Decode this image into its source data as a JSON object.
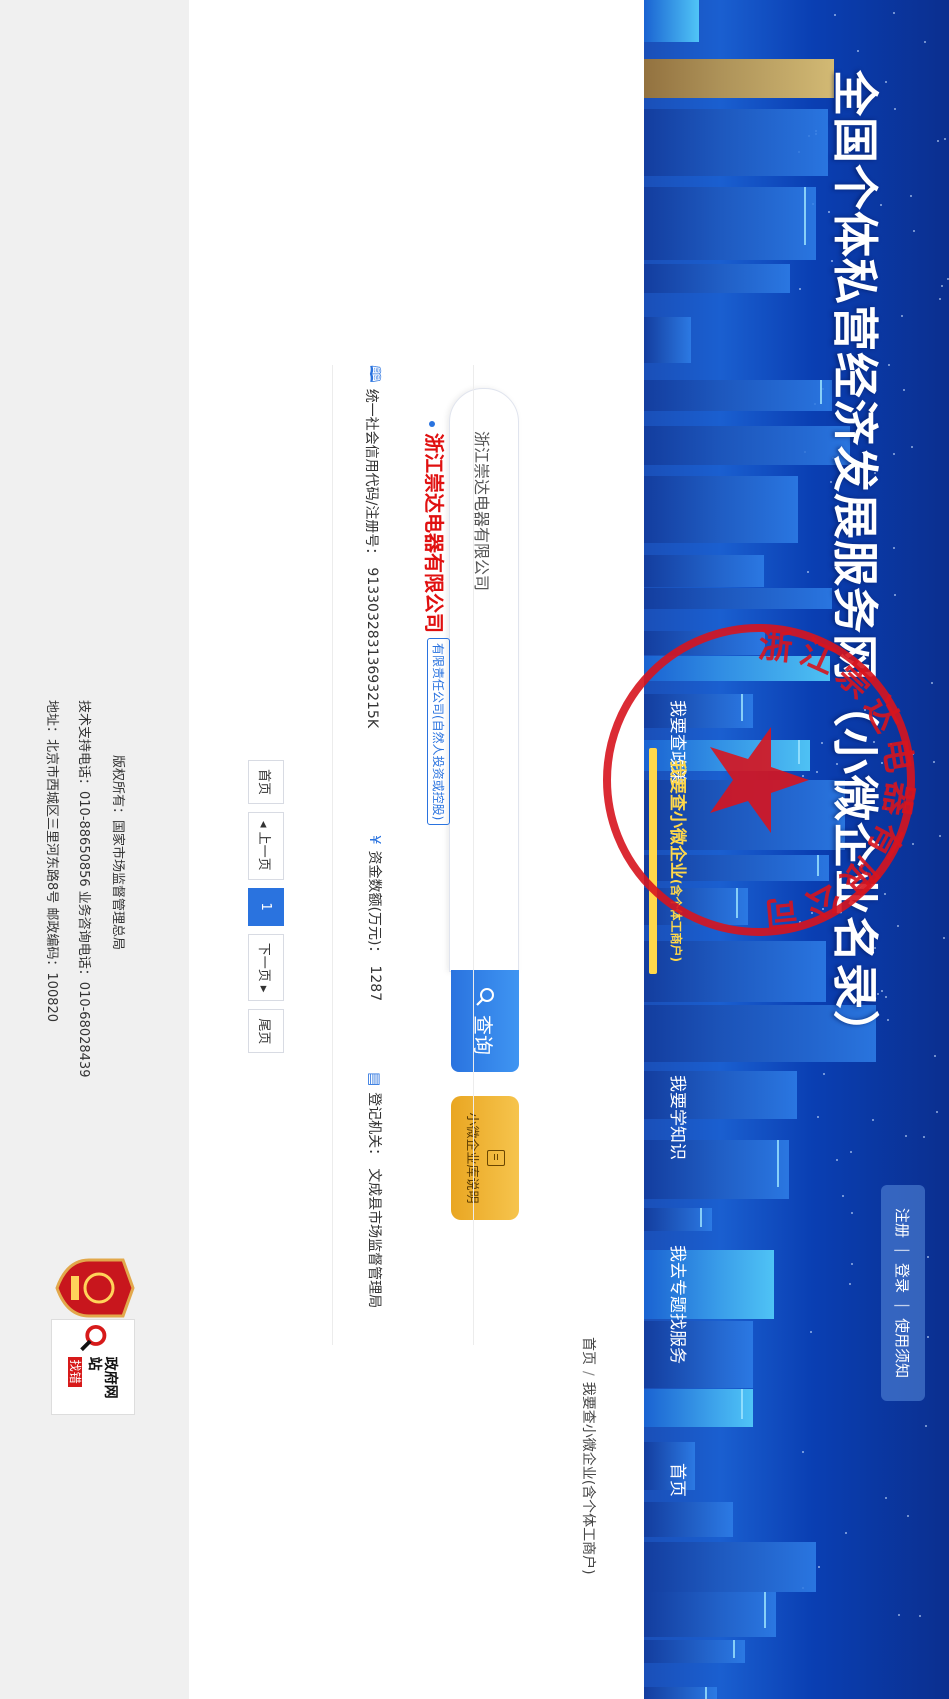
{
  "site": {
    "title": "全国个体私营经济发展服务网（小微企业名录）"
  },
  "user_links": {
    "register": "注册",
    "login": "登录",
    "help": "使用须知",
    "separator": "|"
  },
  "nav": {
    "items": [
      {
        "label": "首页"
      },
      {
        "label": "我要查政策"
      },
      {
        "label": "我要查小微企业",
        "sub": "(含个体工商户)"
      },
      {
        "label": "我要学知识"
      },
      {
        "label": "我去专题找服务"
      }
    ],
    "active_index": 2
  },
  "breadcrumb": {
    "home": "首页",
    "separator": "/",
    "current": "我要查小微企业(含个体工商户)"
  },
  "search": {
    "value": "浙江崇达电器有限公司",
    "button_label": "查询",
    "guide_label": "小微企业库说明"
  },
  "result": {
    "name": "浙江崇达电器有限公司",
    "type": "有限责任公司(自然人投资或控股)",
    "credit_code_label": "统一社会信用代码/注册号：",
    "credit_code": "91330328313693215K",
    "capital_label": "资金数额(万元)：",
    "capital": "1287",
    "authority_label": "登记机关：",
    "authority": "文成县市场监督管理局"
  },
  "pagination": {
    "first": "首页",
    "prev": "◂ 上一页",
    "current": "1",
    "next": "下一页 ▸",
    "last": "尾页"
  },
  "footer": {
    "copyright": "版权所有：国家市场监督管理总局",
    "support": "技术支持电话：010-88650856 业务咨询电话：010-68028439",
    "address": "地址：北京市西城区三里河东路8号 邮政编码：100820",
    "gov_site_line1": "政府网站",
    "gov_site_line2": "找错"
  },
  "seal": {
    "arc_text": "浙江崇达电器有限公司"
  },
  "colors": {
    "accent_blue": "#2a73df",
    "banner_blue": "#0a3fb3",
    "highlight_yellow": "#ffd84a",
    "company_red": "#e01010",
    "seal_red": "#d7141e",
    "guide_yellow": "#f6c44d"
  }
}
